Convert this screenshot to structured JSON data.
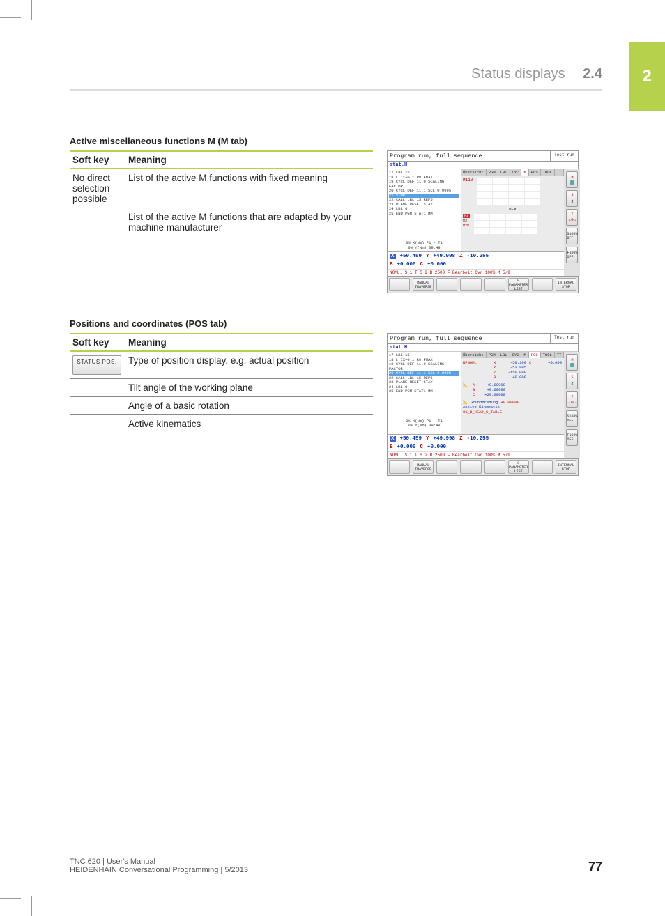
{
  "chapter_tab": "2",
  "header": {
    "title": "Status displays",
    "section": "2.4"
  },
  "section_m": {
    "title": "Active miscellaneous functions M (M tab)",
    "headers": {
      "col1": "Soft key",
      "col2": "Meaning"
    },
    "rows": [
      {
        "softkey_text": "No direct selection possible",
        "meaning": "List of the active M functions with fixed meaning"
      },
      {
        "softkey_text": "",
        "meaning": "List of the active M functions that are adapted by your machine manufacturer"
      }
    ]
  },
  "section_pos": {
    "title": "Positions and coordinates (POS tab)",
    "headers": {
      "col1": "Soft key",
      "col2": "Meaning"
    },
    "rows": [
      {
        "softkey_button": "STATUS POS.",
        "meaning": "Type of position display, e.g. actual position"
      },
      {
        "meaning": "Tilt angle of the working plane"
      },
      {
        "meaning": "Angle of a basic rotation"
      },
      {
        "meaning": "Active kinematics"
      }
    ]
  },
  "screenshot_common": {
    "title": "Program run, full sequence",
    "side_title": "Test run",
    "subtitle": "stat.H",
    "program_lines": [
      "17 LBL 15",
      "18 L IX+0.1 R0 FMAX",
      "19 CYCL DEF 11.0 SCALING FACTOR",
      "20 CYCL DEF 11.1 SCL 0.9995",
      "21 STOP",
      "22 CALL LBL 15 REP5",
      "23 PLANE RESET STAY",
      "24 LBL 0",
      "25 END PGM STAT1 MM"
    ],
    "tabs": [
      "Übersicht",
      "PGM",
      "LBL",
      "CYC",
      "M",
      "POS",
      "TOOL",
      "TT"
    ],
    "graphics_lines": [
      "0% X(Nm) P1 - T1",
      "0% Y(Nm) 09:48"
    ],
    "coords": {
      "X": "+50.459",
      "Y": "+49.998",
      "Z": "-10.255",
      "B": "+0.000",
      "C": "+0.000"
    },
    "status_line": "NOML.       S 1      T     S 2 B 2500 F   Bearbeit   Ovr 100% M 5/9",
    "softkeys": [
      "",
      "MANUAL TRAVERSE",
      "",
      "",
      "",
      "0 PARAMETER LIST",
      "",
      "INTERNAL STOP"
    ],
    "right_labels": [
      "",
      "",
      "",
      "S100% OFF",
      "F100% OFF"
    ]
  },
  "screenshot_m": {
    "active_tab": "M",
    "label": "M110",
    "center_label": "OEM",
    "left_items": [
      "M1",
      "M3",
      "M28"
    ]
  },
  "screenshot_pos": {
    "active_tab": "POS",
    "pos_header": "RFNOML",
    "pos_values": [
      {
        "axis": "X",
        "v": "-50.100",
        "axis2": "C",
        "v2": "+0.000"
      },
      {
        "axis": "Y",
        "v": "-53.805"
      },
      {
        "axis": "Z",
        "v": "-150.000"
      },
      {
        "axis": "B",
        "v": "+0.000"
      }
    ],
    "angle_rows": [
      {
        "axis": "A",
        "v": "+0.00000"
      },
      {
        "axis": "B",
        "v": "+0.00000"
      },
      {
        "axis": "C",
        "v": "+20.00000"
      }
    ],
    "grunddrehung": {
      "label": "Grunddrehung",
      "value": "+0.00000"
    },
    "kinematic_label": "Active Kinematic",
    "kinematic_value": "01_B_HEAD_C_TABLE"
  },
  "footer": {
    "line1": "TNC 620 | User's Manual",
    "line2": "HEIDENHAIN Conversational Programming | 5/2013",
    "page": "77"
  }
}
